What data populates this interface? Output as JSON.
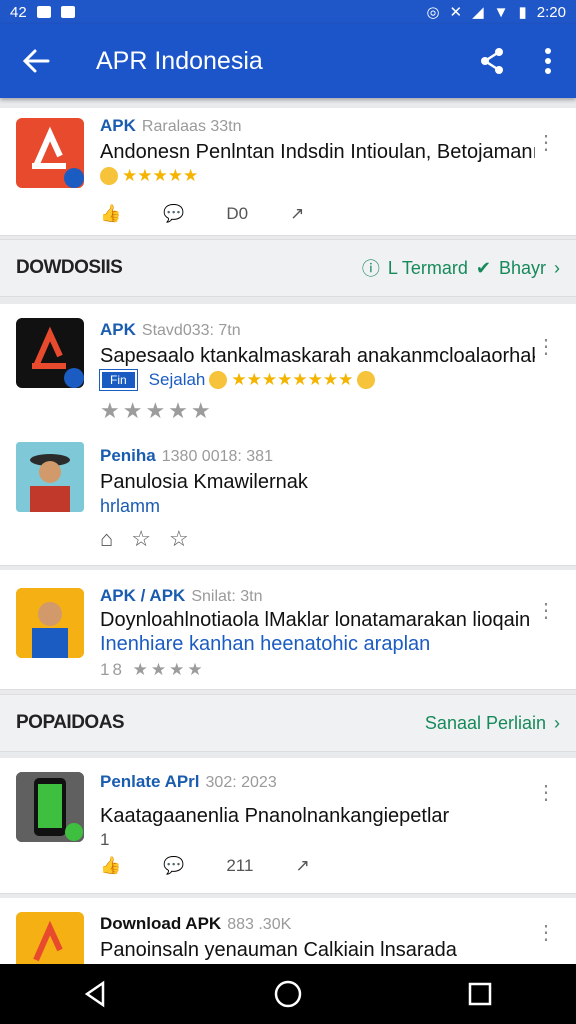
{
  "status": {
    "left_label": "42",
    "time": "2:20"
  },
  "app_bar": {
    "title": "APR Indonesia"
  },
  "top_item": {
    "title": "APK",
    "meta": "Raralaas 33tn",
    "description": "Andonesn Penlntan Indsdin Intioulan, Betojamanı, M",
    "rating": "★★★★★",
    "actions": {
      "count": "D0"
    }
  },
  "section_downloads": {
    "title": "DOWDOSIIS",
    "link_label": "L Termard",
    "link2_label": "Bhayr"
  },
  "downloads": [
    {
      "title": "APK",
      "meta": "Stavd033: 7tn",
      "description": "Sapesaalo ktankalmaskarah anakanmcloalaorhak:",
      "badge": "Fin",
      "tag": "Sejalah",
      "stars": "★★★★★★★★",
      "grey_stars": "★★★★★"
    },
    {
      "title": "Peniha",
      "meta": "1380 0018: 381",
      "description": "Panulosia Kmawilernak",
      "sub": "hrlamm"
    },
    {
      "title": "APK / APK",
      "meta": "Snilat: 3tn",
      "description_line1": "Doynloahlnotiaola lMaklar lonatamarakan lioqain",
      "description_line2": "Inenhiare kanhan heenatohic araplan",
      "count": "18",
      "stars": "★★★★"
    }
  ],
  "section_popular": {
    "title": "POPAIDOAS",
    "link_label": "Sanaal Perliain"
  },
  "popular": [
    {
      "title": "Penlate APrl",
      "meta": "302: 2023",
      "description": "Kaatagaanenlia Pnanolnankangiepetlar",
      "count": "1",
      "comments": "211"
    },
    {
      "title": "Download APK",
      "meta": "883 .30K",
      "description": "Panoinsaln yenauman Calkiain lnsarada"
    }
  ]
}
